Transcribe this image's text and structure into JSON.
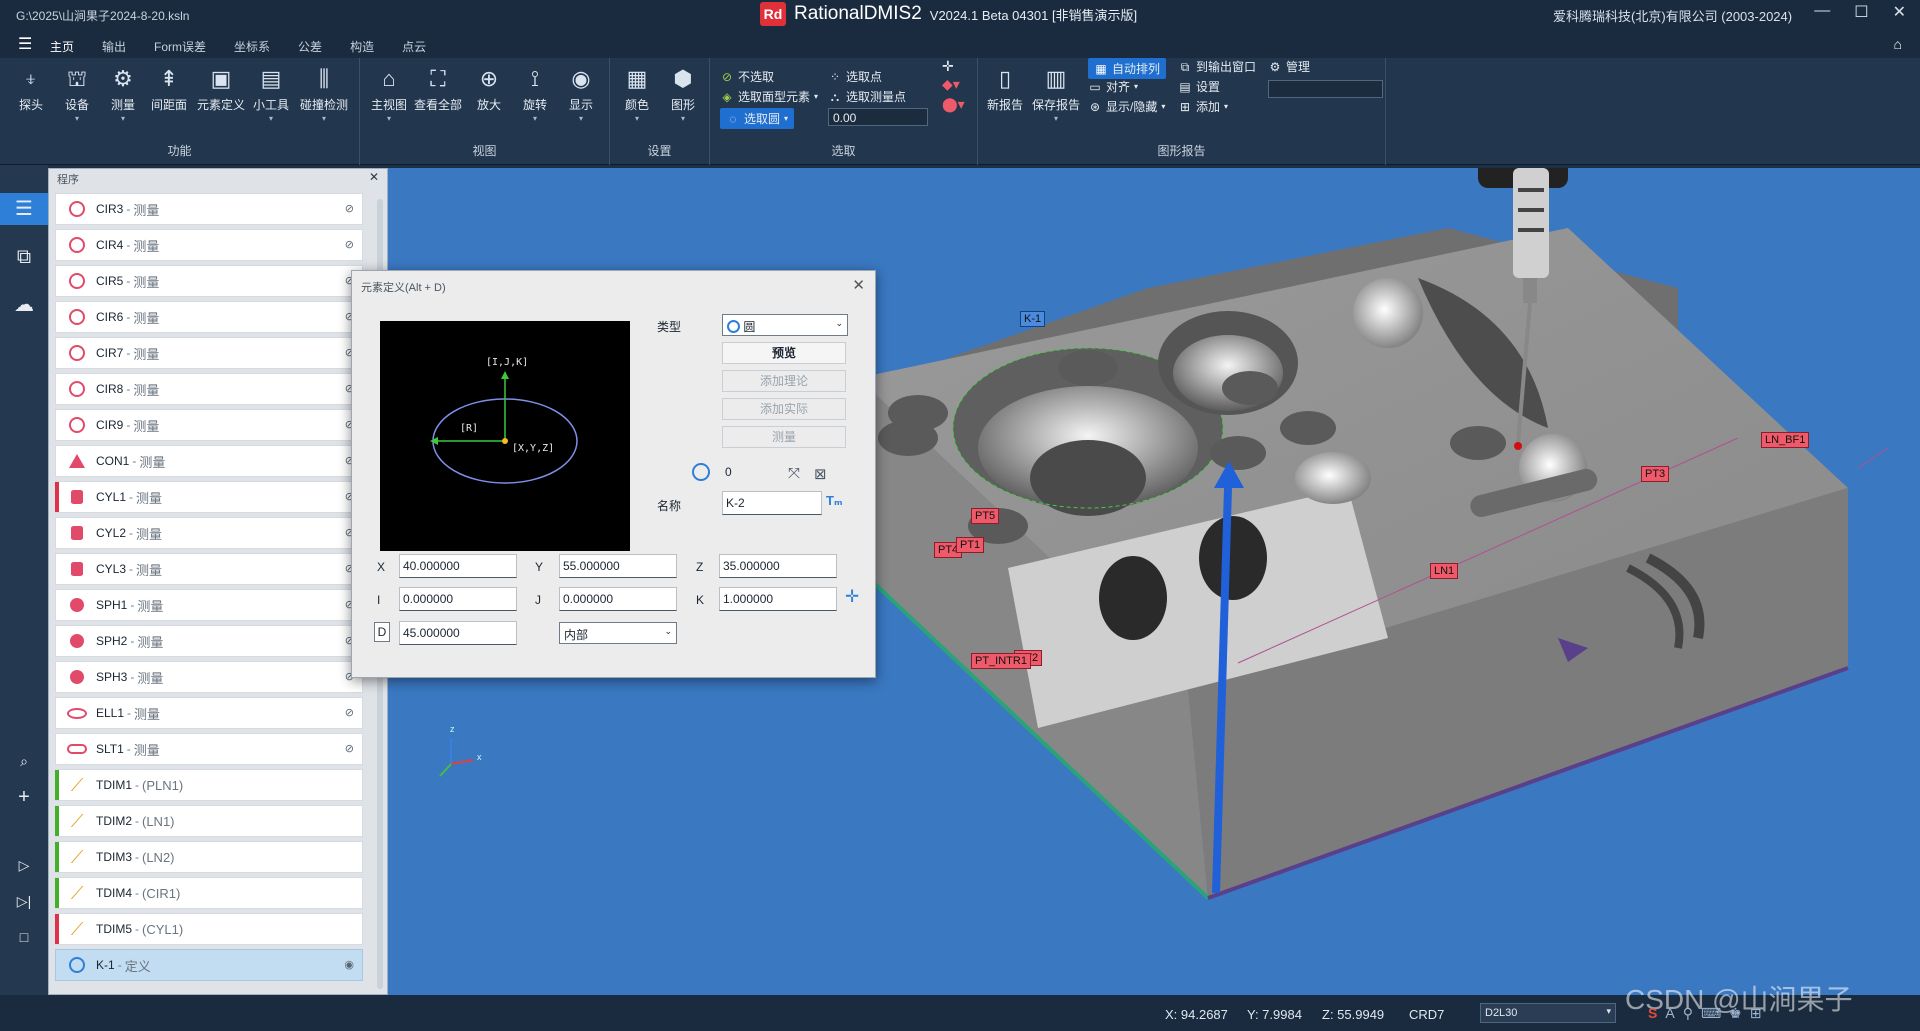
{
  "title": {
    "path": "G:\\2025\\山涧果子2024-8-20.ksln",
    "logo": "Rd",
    "app": "RationalDMIS2",
    "version": "V2024.1 Beta 04301 [非销售演示版]",
    "company": "爱科腾瑞科技(北京)有限公司 (2003-2024)"
  },
  "menu": {
    "tabs": [
      "主页",
      "输出",
      "Form误差",
      "坐标系",
      "公差",
      "构造",
      "点云"
    ]
  },
  "ribbon": {
    "func": {
      "title": "功能",
      "tools": [
        "探头",
        "设备",
        "测量",
        "间距面",
        "元素定义",
        "小工具",
        "碰撞检测"
      ]
    },
    "view": {
      "title": "视图",
      "tools": [
        "主视图",
        "查看全部",
        "放大",
        "旋转",
        "显示"
      ]
    },
    "settings": {
      "title": "设置",
      "tools": [
        "颜色",
        "图形"
      ]
    },
    "select": {
      "title": "选取",
      "no_select": "不选取",
      "select_face": "选取面型元素",
      "select_circle": "选取圆",
      "select_point": "选取点",
      "select_measured": "选取测量点",
      "value": "0.00"
    },
    "report": {
      "title": "图形报告",
      "new_report": "新报告",
      "save_report": "保存报告",
      "auto_arrange": "自动排列",
      "align": "对齐",
      "show_hide": "显示/隐藏",
      "to_output": "到输出窗口",
      "settings": "设置",
      "add": "添加",
      "manage": "管理"
    }
  },
  "panel": {
    "title": "程序",
    "items": [
      {
        "name": "CIR3",
        "kind": "测量",
        "icon": "circle",
        "mark": ""
      },
      {
        "name": "CIR4",
        "kind": "测量",
        "icon": "circle",
        "mark": ""
      },
      {
        "name": "CIR5",
        "kind": "测量",
        "icon": "circle",
        "mark": ""
      },
      {
        "name": "CIR6",
        "kind": "测量",
        "icon": "circle",
        "mark": ""
      },
      {
        "name": "CIR7",
        "kind": "测量",
        "icon": "circle",
        "mark": ""
      },
      {
        "name": "CIR8",
        "kind": "测量",
        "icon": "circle",
        "mark": ""
      },
      {
        "name": "CIR9",
        "kind": "测量",
        "icon": "circle",
        "mark": ""
      },
      {
        "name": "CON1",
        "kind": "测量",
        "icon": "cone",
        "mark": ""
      },
      {
        "name": "CYL1",
        "kind": "测量",
        "icon": "cylinder",
        "mark": "#e0304a"
      },
      {
        "name": "CYL2",
        "kind": "测量",
        "icon": "cylinder",
        "mark": ""
      },
      {
        "name": "CYL3",
        "kind": "测量",
        "icon": "cylinder",
        "mark": ""
      },
      {
        "name": "SPH1",
        "kind": "测量",
        "icon": "sphere",
        "mark": ""
      },
      {
        "name": "SPH2",
        "kind": "测量",
        "icon": "sphere",
        "mark": ""
      },
      {
        "name": "SPH3",
        "kind": "测量",
        "icon": "sphere",
        "mark": ""
      },
      {
        "name": "ELL1",
        "kind": "测量",
        "icon": "ellipse",
        "mark": ""
      },
      {
        "name": "SLT1",
        "kind": "测量",
        "icon": "slot",
        "mark": ""
      },
      {
        "name": "TDIM1",
        "kind": "(PLN1)",
        "icon": "ruler",
        "mark": "#44b02a"
      },
      {
        "name": "TDIM2",
        "kind": "(LN1)",
        "icon": "ruler",
        "mark": "#44b02a"
      },
      {
        "name": "TDIM3",
        "kind": "(LN2)",
        "icon": "ruler",
        "mark": "#44b02a"
      },
      {
        "name": "TDIM4",
        "kind": "(CIR1)",
        "icon": "ruler",
        "mark": "#44b02a"
      },
      {
        "name": "TDIM5",
        "kind": "(CYL1)",
        "icon": "ruler",
        "mark": "#e0304a"
      },
      {
        "name": "K-1",
        "kind": "定义",
        "icon": "circle-blue",
        "mark": "",
        "selected": true
      }
    ]
  },
  "dialog": {
    "title": "元素定义(Alt + D)",
    "preview": {
      "ijk": "[I,J,K]",
      "r": "[R]",
      "xyz": "[X,Y,Z]"
    },
    "type_label": "类型",
    "type_value": "圆",
    "buttons": {
      "preview": "预览",
      "add_theory": "添加理论",
      "add_actual": "添加实际",
      "measure": "测量"
    },
    "count": "0",
    "name_label": "名称",
    "name_value": "K-2",
    "x_label": "X",
    "x": "40.000000",
    "y_label": "Y",
    "y": "55.000000",
    "z_label": "Z",
    "z": "35.000000",
    "i_label": "I",
    "i": "0.000000",
    "j_label": "J",
    "j": "0.000000",
    "k_label": "K",
    "k": "1.000000",
    "d_label": "D",
    "d": "45.000000",
    "side": "内部"
  },
  "viewport": {
    "tags": {
      "k1": "K-1",
      "ln_bf1": "LN_BF1",
      "pt3": "PT3",
      "pt5": "PT5",
      "pt4": "PT4",
      "pt1": "PT1",
      "ln1": "LN1",
      "pt_intr1": "PT_INTR1",
      "pt2": "PT2"
    },
    "axis_z": "z",
    "triad": {
      "x": "x",
      "z": "z"
    }
  },
  "status": {
    "x": "X: 94.2687",
    "y": "Y: 7.9984",
    "z": "Z: 55.9949",
    "crd": "CRD7",
    "dropdown": "D2L30"
  },
  "watermark": "CSDN @山涧果子",
  "colors": {
    "accent": "#2e7fd8",
    "viewport_bg": "#3a78c2",
    "feature_red": "#e24a6a"
  }
}
